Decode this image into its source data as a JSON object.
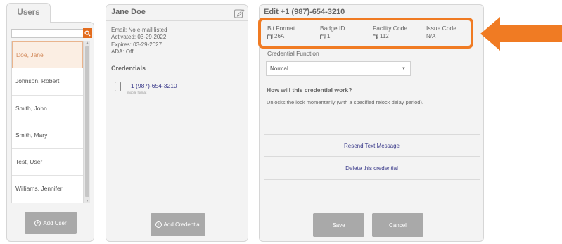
{
  "users_panel": {
    "tab_label": "Users",
    "search_placeholder": "",
    "users": [
      "Doe, Jane",
      "Johnson, Robert",
      "Smith, John",
      "Smith, Mary",
      "Test, User",
      "Williams, Jennifer"
    ],
    "selected_index": 0,
    "add_user_label": "Add User"
  },
  "person_panel": {
    "name": "Jane Doe",
    "info": {
      "email": "Email: No e-mail listed",
      "activated": "Activated: 03-29-2022",
      "expires": "Expires: 03-29-2027",
      "ada": "ADA: Off"
    },
    "credentials_heading": "Credentials",
    "credential": {
      "number": "+1 (987)-654-3210",
      "type": "mobile format"
    },
    "add_credential_label": "Add Credential"
  },
  "edit_panel": {
    "title": "Edit +1 (987)-654-3210",
    "fields": {
      "bit_format": {
        "label": "Bit Format",
        "value": "26A"
      },
      "badge_id": {
        "label": "Badge ID",
        "value": "1"
      },
      "facility_code": {
        "label": "Facility Code",
        "value": "112"
      },
      "issue_code": {
        "label": "Issue Code",
        "value": "N/A"
      }
    },
    "credential_function_label": "Credential Function",
    "credential_function_value": "Normal",
    "how_heading": "How will this credential work?",
    "how_description": "Unlocks the lock momentarily (with a specified relock delay period).",
    "resend_label": "Resend Text Message",
    "delete_label": "Delete this credential",
    "save_label": "Save",
    "cancel_label": "Cancel"
  },
  "colors": {
    "accent": "#f07b23",
    "selected_bg": "#fbeee3",
    "button_gray": "#a9a9a9",
    "link": "#3a3a8a"
  },
  "icons": [
    "search-icon",
    "edit-pencil-icon",
    "phone-icon",
    "copy-icon",
    "plus-circle-icon",
    "chevron-down-icon",
    "callout-arrow"
  ]
}
